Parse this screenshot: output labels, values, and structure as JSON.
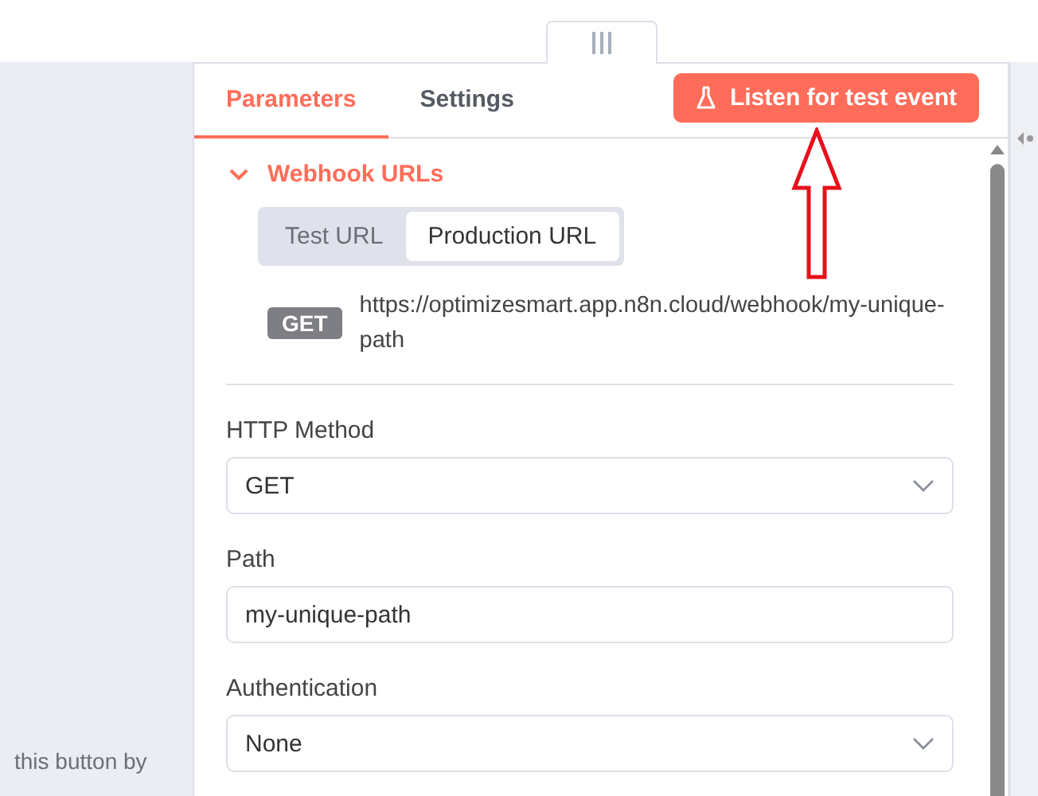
{
  "canvas_hint": "this button by",
  "tabs": [
    {
      "label": "Parameters",
      "selected": true
    },
    {
      "label": "Settings",
      "selected": false
    }
  ],
  "listen_button": "Listen for test event",
  "section": {
    "title": "Webhook URLs",
    "expanded": true,
    "url_toggle": [
      {
        "label": "Test URL",
        "selected": false
      },
      {
        "label": "Production URL",
        "selected": true
      }
    ],
    "method_badge": "GET",
    "url": "https://optimizesmart.app.n8n.cloud/webhook/my-unique-path"
  },
  "fields": [
    {
      "label": "HTTP Method",
      "kind": "select",
      "value": "GET"
    },
    {
      "label": "Path",
      "kind": "input",
      "value": "my-unique-path"
    },
    {
      "label": "Authentication",
      "kind": "select",
      "value": "None"
    }
  ]
}
